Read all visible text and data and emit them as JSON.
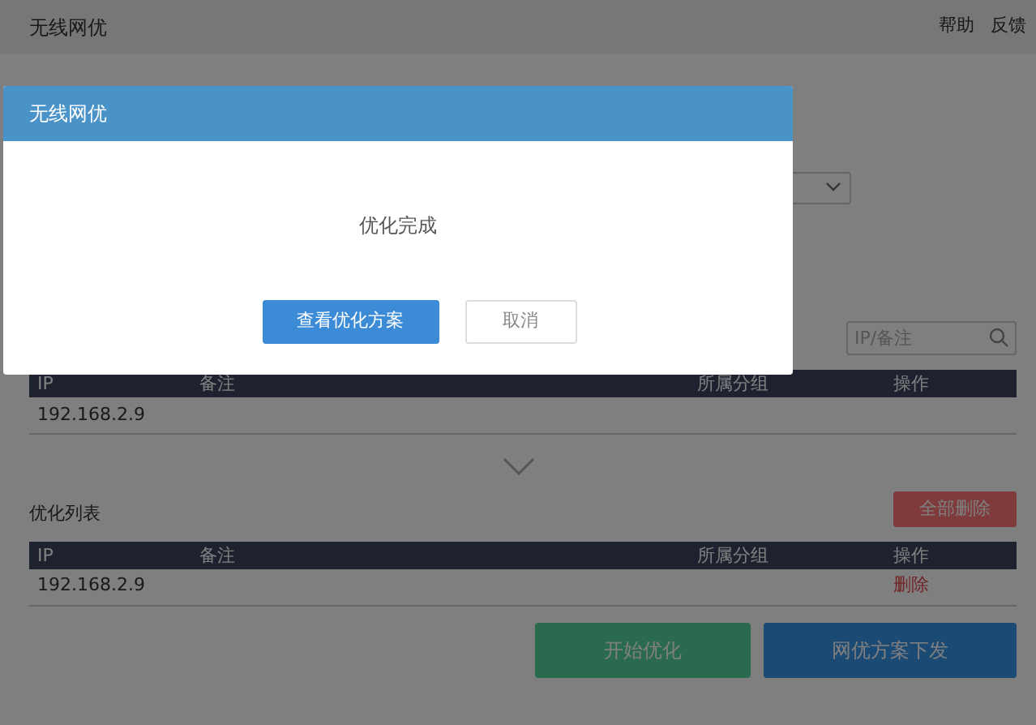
{
  "app": {
    "title": "无线网优",
    "links": [
      "帮助",
      "反馈"
    ]
  },
  "search": {
    "placeholder": "IP/备注"
  },
  "device_table": {
    "columns": [
      "IP",
      "备注",
      "所属分组",
      "操作"
    ],
    "rows": [
      {
        "ip": "192.168.2.9"
      }
    ]
  },
  "optimize_list": {
    "title": "优化列表",
    "delete_all": "全部删除",
    "columns": [
      "IP",
      "备注",
      "所属分组",
      "操作"
    ],
    "rows": [
      {
        "ip": "192.168.2.9",
        "action": "删除"
      }
    ]
  },
  "actions": [
    {
      "label": "开始优化",
      "kind": "success"
    },
    {
      "label": "网优方案下发",
      "kind": "primary"
    }
  ],
  "dialog": {
    "title": "无线网优",
    "message": "优化完成",
    "buttons": [
      {
        "label": "查看优化方案",
        "kind": "primary"
      },
      {
        "label": "取消",
        "kind": "secondary"
      }
    ]
  }
}
